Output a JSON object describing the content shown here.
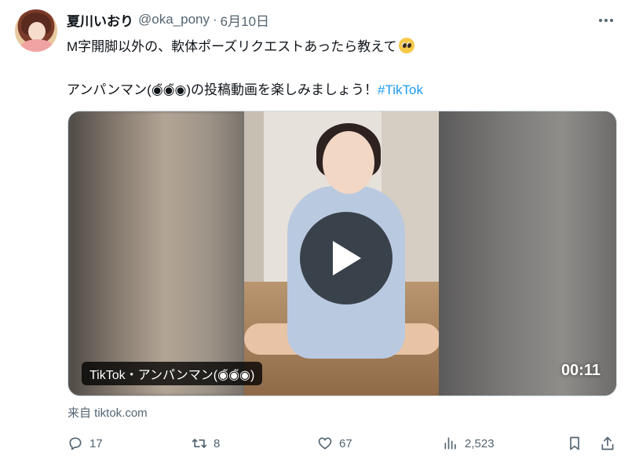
{
  "user": {
    "display_name": "夏川いおり",
    "handle": "@oka_pony",
    "separator": "·",
    "date": "6月10日"
  },
  "tweet": {
    "line1": "M字開脚以外の、軟体ポーズリクエストあったら教えて",
    "line1_emoji": "pleading-face-emoji",
    "line2": "アンパンマン(◉̃◉̃◉)の投稿動画を楽しみましょう！",
    "hashtag": "#TikTok"
  },
  "media": {
    "source_chip": "TikTok・アンパンマン(◉̃◉̃◉)",
    "duration": "00:11",
    "from_line": "来自 tiktok.com"
  },
  "actions": {
    "replies": "17",
    "reposts": "8",
    "likes": "67",
    "views": "2,523"
  },
  "colors": {
    "text": "#0f1419",
    "secondary": "#536471",
    "link": "#1d9bf0"
  },
  "icons": [
    "more-icon",
    "reply-icon",
    "repost-icon",
    "like-icon",
    "views-icon",
    "bookmark-icon",
    "share-icon",
    "play-icon"
  ]
}
